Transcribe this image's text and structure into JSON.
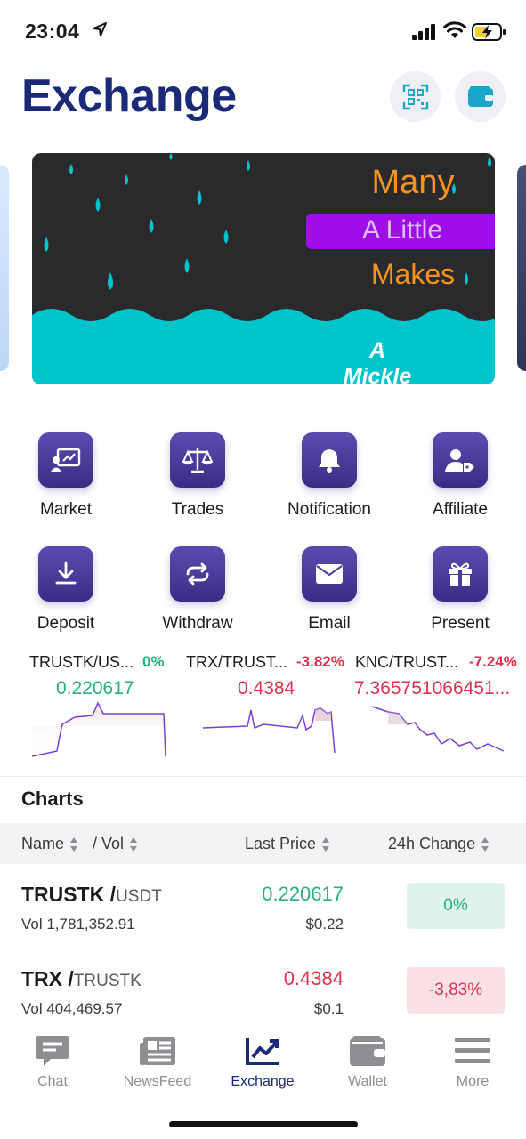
{
  "status_bar": {
    "time": "23:04"
  },
  "header": {
    "title": "Exchange"
  },
  "banner": {
    "line1": "Many",
    "line2": "A Little",
    "line3": "Makes",
    "line4": "A Mickle"
  },
  "actions": [
    {
      "label": "Market",
      "icon": "market-icon"
    },
    {
      "label": "Trades",
      "icon": "scales-icon"
    },
    {
      "label": "Notification",
      "icon": "bell-icon"
    },
    {
      "label": "Affiliate",
      "icon": "user-tag-icon"
    },
    {
      "label": "Deposit",
      "icon": "download-icon"
    },
    {
      "label": "Withdraw",
      "icon": "exchange-arrows-icon"
    },
    {
      "label": "Email",
      "icon": "envelope-icon"
    },
    {
      "label": "Present",
      "icon": "gift-icon"
    }
  ],
  "tickers": [
    {
      "pair": "TRUSTK/US...",
      "change": "0%",
      "price": "0.220617",
      "trend": "neutral"
    },
    {
      "pair": "TRX/TRUST...",
      "change": "-3.82%",
      "price": "0.4384",
      "trend": "down"
    },
    {
      "pair": "KNC/TRUST...",
      "change": "-7.24%",
      "price": "7.365751066451...",
      "trend": "down"
    }
  ],
  "charts": {
    "title": "Charts",
    "columns": {
      "name": "Name",
      "vol": "/ Vol",
      "last_price": "Last Price",
      "change": "24h Change"
    },
    "rows": [
      {
        "base": "TRUSTK /",
        "quote": "USDT",
        "vol": "Vol 1,781,352.91",
        "price": "0.220617",
        "usd": "$0.22",
        "change": "0%",
        "trend": "neutral"
      },
      {
        "base": "TRX /",
        "quote": "TRUSTK",
        "vol": "Vol 404,469.57",
        "price": "0.4384",
        "usd": "$0.1",
        "change": "-3,83%",
        "trend": "down"
      }
    ]
  },
  "tab_bar": {
    "tabs": [
      {
        "label": "Chat",
        "icon": "chat-icon",
        "active": false
      },
      {
        "label": "NewsFeed",
        "icon": "newspaper-icon",
        "active": false
      },
      {
        "label": "Exchange",
        "icon": "chart-line-icon",
        "active": true
      },
      {
        "label": "Wallet",
        "icon": "wallet-icon",
        "active": false
      },
      {
        "label": "More",
        "icon": "menu-icon",
        "active": false
      }
    ]
  },
  "colors": {
    "brand": "#1a2a78",
    "accent": "#4a3b9c",
    "up": "#28b17b",
    "down": "#e0324d",
    "banner_orange": "#f6931d",
    "banner_purple": "#a10dea",
    "banner_teal": "#00c4cc"
  }
}
